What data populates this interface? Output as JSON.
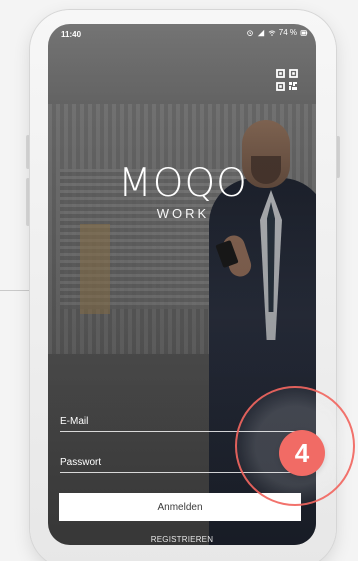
{
  "status": {
    "time": "11:40",
    "battery": "74 %"
  },
  "app": {
    "logo_primary": "MOQO",
    "logo_secondary": "WORK"
  },
  "form": {
    "email_label": "E-Mail",
    "password_label": "Passwort",
    "login_label": "Anmelden",
    "register_label": "REGISTRIEREN"
  },
  "callout": {
    "number": "4"
  },
  "colors": {
    "callout": "#f16b65",
    "screen_text": "#ffffff",
    "button_bg": "#ffffff"
  },
  "icons": {
    "qr": "qr-code-icon",
    "alarm": "alarm-icon",
    "wifi": "wifi-icon",
    "signal": "signal-icon",
    "battery": "battery-icon"
  }
}
